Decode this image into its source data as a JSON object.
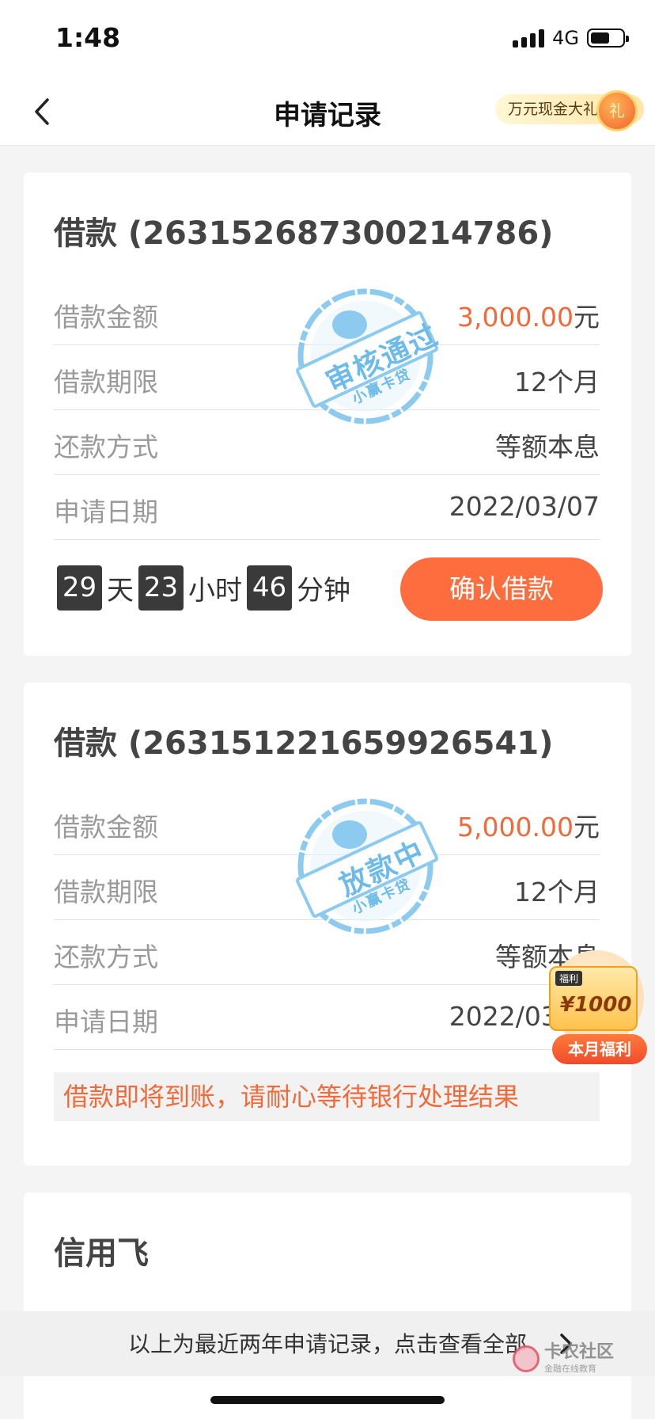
{
  "status_bar": {
    "time": "1:48",
    "network": "4G",
    "battery_level": 0.6
  },
  "nav": {
    "title": "申请记录",
    "promo_label": "万元现金大礼",
    "promo_icon_text": "礼"
  },
  "records": [
    {
      "title": "借款 (263152687300214786)",
      "rows": [
        {
          "label": "借款金额",
          "value": "3,000.00",
          "unit": "元"
        },
        {
          "label": "借款期限",
          "value": "12个月"
        },
        {
          "label": "还款方式",
          "value": "等额本息"
        },
        {
          "label": "申请日期",
          "value": "2022/03/07"
        }
      ],
      "stamp": {
        "text": "审核通过",
        "org": "小赢卡贷"
      },
      "countdown": {
        "days": "29",
        "days_unit": "天",
        "hours": "23",
        "hours_unit": "小时",
        "minutes": "46",
        "minutes_unit": "分钟"
      },
      "action_label": "确认借款"
    },
    {
      "title": "借款 (263151221659926541)",
      "rows": [
        {
          "label": "借款金额",
          "value": "5,000.00",
          "unit": "元"
        },
        {
          "label": "借款期限",
          "value": "12个月"
        },
        {
          "label": "还款方式",
          "value": "等额本息"
        },
        {
          "label": "申请日期",
          "value": "2022/03/07"
        }
      ],
      "stamp": {
        "text": "放款中",
        "org": "小赢卡贷"
      },
      "notice": "借款即将到账，请耐心等待银行处理结果"
    },
    {
      "title": "信用飞"
    }
  ],
  "floating_widget": {
    "tag": "福利",
    "amount": "¥1000",
    "button": "本月福利"
  },
  "footer": {
    "text": "以上为最近两年申请记录，点击查看全部"
  },
  "watermark": {
    "main": "卡农社区",
    "sub": "金融在线教育"
  },
  "colors": {
    "accent": "#fd6d3e",
    "amount": "#f06a3a",
    "stamp": "#6dbbe8"
  }
}
